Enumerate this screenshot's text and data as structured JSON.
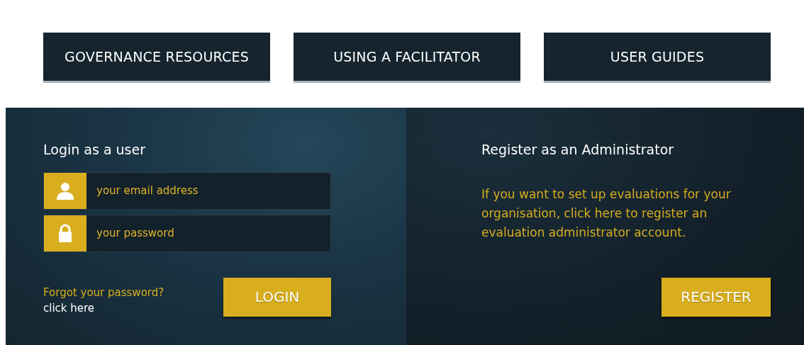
{
  "nav_buttons": [
    {
      "label": "GOVERNANCE RESOURCES"
    },
    {
      "label": "USING A FACILITATOR"
    },
    {
      "label": "USER GUIDES"
    }
  ],
  "login": {
    "title": "Login as a user",
    "fields": [
      {
        "kind": "email",
        "placeholder": "your email address"
      },
      {
        "kind": "password",
        "placeholder": "your password"
      }
    ],
    "forgot_text": "Forgot your password?",
    "forgot_link": "click here",
    "button": "LOGIN"
  },
  "register": {
    "title": "Register as an Administrator",
    "description": "If you want to set up evaluations for your organisation, click here to register an evaluation administrator account.",
    "button": "REGISTER"
  }
}
